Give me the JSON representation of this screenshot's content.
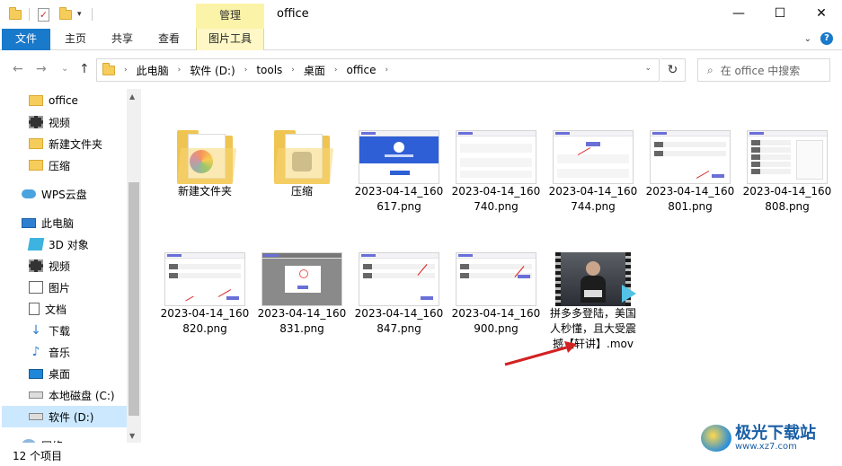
{
  "window": {
    "title": "office",
    "context_tab": "管理",
    "controls": {
      "minimize": "—",
      "maximize": "☐",
      "close": "✕"
    }
  },
  "quick_access": {
    "dropdown": "▾"
  },
  "ribbon": {
    "tabs": [
      "文件",
      "主页",
      "共享",
      "查看",
      "图片工具"
    ],
    "expand": "⌄",
    "help": "?"
  },
  "nav": {
    "back": "←",
    "forward": "→",
    "recent": "⌄",
    "up": "↑"
  },
  "address": {
    "crumbs": [
      "此电脑",
      "软件 (D:)",
      "tools",
      "桌面",
      "office"
    ],
    "sep": "›",
    "dropdown": "⌄",
    "refresh": "↻"
  },
  "search": {
    "placeholder": "在 office 中搜索",
    "icon": "⌕"
  },
  "sidebar": {
    "items": [
      {
        "label": "office",
        "icon": "folder-icon"
      },
      {
        "label": "视频",
        "icon": "video-icon"
      },
      {
        "label": "新建文件夹",
        "icon": "folder-icon"
      },
      {
        "label": "压缩",
        "icon": "folder-icon"
      },
      {
        "label": "WPS云盘",
        "icon": "cloud-icon"
      },
      {
        "label": "此电脑",
        "icon": "computer-icon"
      },
      {
        "label": "3D 对象",
        "icon": "cube-icon"
      },
      {
        "label": "视频",
        "icon": "video-icon"
      },
      {
        "label": "图片",
        "icon": "picture-icon"
      },
      {
        "label": "文档",
        "icon": "document-icon"
      },
      {
        "label": "下载",
        "icon": "download-icon"
      },
      {
        "label": "音乐",
        "icon": "music-icon"
      },
      {
        "label": "桌面",
        "icon": "desktop-icon"
      },
      {
        "label": "本地磁盘 (C:)",
        "icon": "drive-icon"
      },
      {
        "label": "软件 (D:)",
        "icon": "drive-icon"
      },
      {
        "label": "网络",
        "icon": "network-icon"
      }
    ],
    "selected": "软件 (D:)",
    "scroll_up": "▲",
    "scroll_down": "▼"
  },
  "files": [
    {
      "name": "新建文件夹",
      "type": "folder"
    },
    {
      "name": "压缩",
      "type": "folder"
    },
    {
      "name": "2023-04-14_160617.png",
      "type": "image"
    },
    {
      "name": "2023-04-14_160740.png",
      "type": "image"
    },
    {
      "name": "2023-04-14_160744.png",
      "type": "image"
    },
    {
      "name": "2023-04-14_160801.png",
      "type": "image"
    },
    {
      "name": "2023-04-14_160808.png",
      "type": "image"
    },
    {
      "name": "2023-04-14_160820.png",
      "type": "image"
    },
    {
      "name": "2023-04-14_160831.png",
      "type": "image"
    },
    {
      "name": "2023-04-14_160847.png",
      "type": "image"
    },
    {
      "name": "2023-04-14_160900.png",
      "type": "image"
    },
    {
      "name": "拼多多登陆，美国人秒懂，且大受震撼【轩讲】.mov",
      "type": "video"
    }
  ],
  "status": {
    "count": "12 个项目"
  },
  "watermark": {
    "brand": "极光下载站",
    "url": "www.xz7.com"
  },
  "colors": {
    "file_tab": "#1979ca",
    "context_tab": "#fbf3a8",
    "selection": "#cce8ff",
    "arrow": "#d22222"
  }
}
